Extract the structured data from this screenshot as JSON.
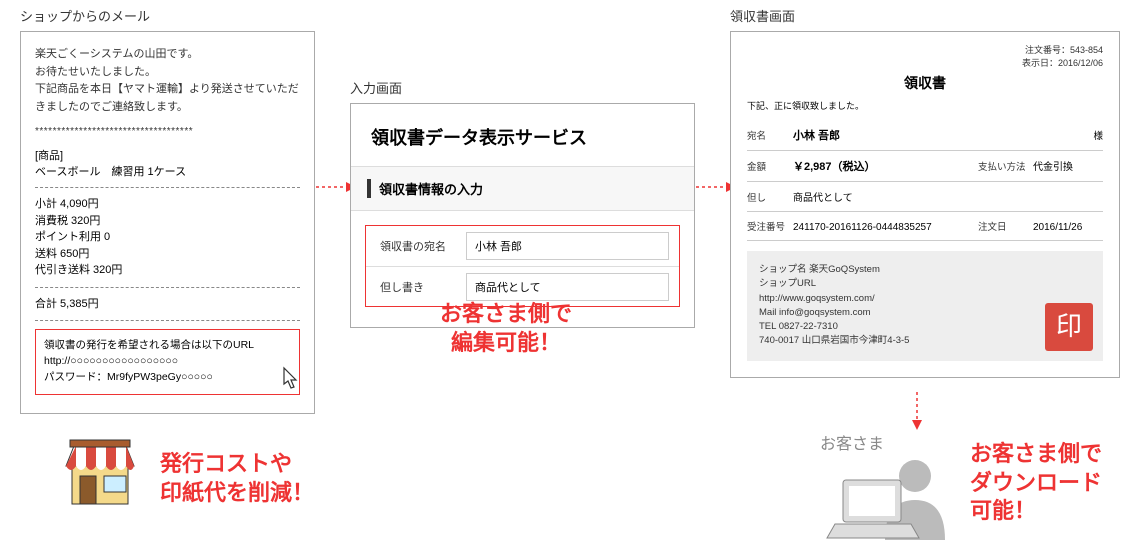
{
  "email": {
    "title": "ショップからのメール",
    "line1": "楽天ごくーシステムの山田です。",
    "line2": "お待たせいたしました。",
    "line3": "下記商品を本日【ヤマト運輸】より発送させていただきましたのでご連絡致します。",
    "sep": "************************************",
    "product_head": "[商品]",
    "product_line": "ベースボール　練習用 1ケース",
    "subtotal": "小計 4,090円",
    "tax": "消費税 320円",
    "points": "ポイント利用 0",
    "shipping": "送料 650円",
    "cod": "代引き送料 320円",
    "total": "合計 5,385円",
    "url_msg": "領収書の発行を希望される場合は以下のURL",
    "url_line": "http://○○○○○○○○○○○○○○○○○",
    "pass_line": "パスワード：Mr9fyPW3peGy○○○○○"
  },
  "callout1_l1": "発行コストや",
  "callout1_l2": "印紙代を削減！",
  "form": {
    "title": "入力画面",
    "heading": "領収書データ表示サービス",
    "sub": "領収書情報の入力",
    "field1_label": "領収書の宛名",
    "field1_value": "小林 吾郎",
    "field2_label": "但し書き",
    "field2_value": "商品代として"
  },
  "callout2_l1": "お客さま側で",
  "callout2_l2": "編集可能！",
  "receipt": {
    "title": "領収書画面",
    "order_no_label": "注文番号：",
    "order_no": "543-854",
    "date_label": "表示日：",
    "date": "2016/12/06",
    "heading": "領収書",
    "note": "下記、正に領収致しました。",
    "name_label": "宛名",
    "name_value": "小林 吾郎",
    "sama": "様",
    "amount_label": "金額",
    "amount_value": "￥2,987（税込）",
    "pay_label": "支払い方法",
    "pay_value": "代金引換",
    "tadashi_label": "但し",
    "tadashi_value": "商品代として",
    "accept_label": "受注番号",
    "accept_value": "241170-20161126-0444835257",
    "orderdate_label": "注文日",
    "orderdate_value": "2016/11/26",
    "shop_l1": "ショップ名 楽天GoQSystem",
    "shop_l2": "ショップURL",
    "shop_l3": "http://www.goqsystem.com/",
    "shop_l4": "Mail  info@goqsystem.com",
    "shop_l5": "TEL 0827-22-7310",
    "shop_l6": "740-0017 山口県岩国市今津町4-3-5",
    "stamp": "印"
  },
  "customer_label": "お客さま",
  "callout3_l1": "お客さま側で",
  "callout3_l2": "ダウンロード",
  "callout3_l3": "可能！"
}
